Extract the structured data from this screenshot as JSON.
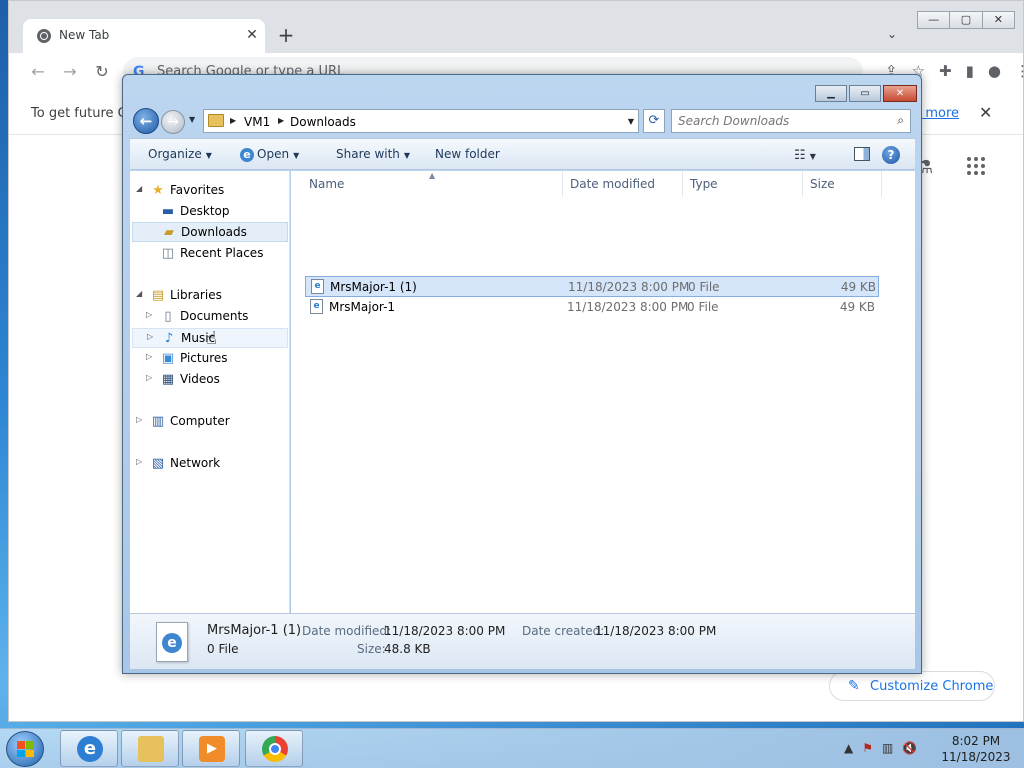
{
  "chrome": {
    "tab_title": "New Tab",
    "tab_close": "✕",
    "new_tab": "+",
    "tab_search": "⌄",
    "omnibox_placeholder": "Search Google or type a URL",
    "omnibox_icon": "G",
    "infobar_message": "To get future Go",
    "infobar_link": "n more",
    "infobar_close": "✕",
    "customize_label": "Customize Chrome",
    "win_minimize": "—",
    "win_restore": "▢",
    "win_close": "✕"
  },
  "explorer": {
    "path": [
      "VM1",
      "Downloads"
    ],
    "search_placeholder": "Search Downloads",
    "commands": {
      "organize": "Organize",
      "open": "Open",
      "share_with": "Share with",
      "new_folder": "New folder"
    },
    "nav": {
      "favorites": "Favorites",
      "desktop": "Desktop",
      "downloads": "Downloads",
      "recent_places": "Recent Places",
      "libraries": "Libraries",
      "documents": "Documents",
      "music": "Music",
      "pictures": "Pictures",
      "videos": "Videos",
      "computer": "Computer",
      "network": "Network"
    },
    "columns": {
      "name": "Name",
      "date_modified": "Date modified",
      "type": "Type",
      "size": "Size"
    },
    "files": [
      {
        "name": "MrsMajor-1 (1)",
        "date": "11/18/2023 8:00 PM",
        "type": "0 File",
        "size": "49 KB"
      },
      {
        "name": "MrsMajor-1",
        "date": "11/18/2023 8:00 PM",
        "type": "0 File",
        "size": "49 KB"
      }
    ],
    "details": {
      "name": "MrsMajor-1 (1)",
      "type": "0 File",
      "date_modified_label": "Date modified:",
      "date_modified": "11/18/2023 8:00 PM",
      "date_created_label": "Date created:",
      "date_created": "11/18/2023 8:00 PM",
      "size_label": "Size:",
      "size": "48.8 KB"
    }
  },
  "taskbar": {
    "time": "8:02 PM",
    "date": "11/18/2023"
  },
  "colors": {
    "selection": "#d5e6fb",
    "link": "#1a73e8",
    "explorer_frame": "#bcd6f0"
  }
}
